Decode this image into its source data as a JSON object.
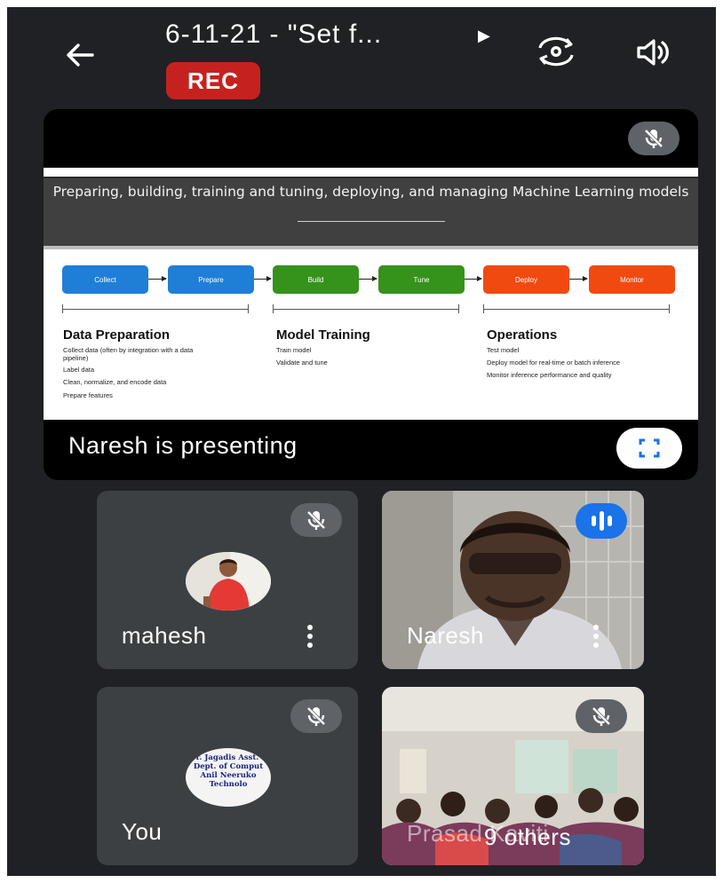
{
  "header": {
    "title": "6-11-21 - \"Set f...",
    "rec_label": "REC"
  },
  "icons": {
    "back": "arrow-left-icon",
    "title_expand": "triangle-right-icon",
    "camera_switch": "camera-switch-icon",
    "speaker": "speaker-icon",
    "mic_off": "mic-off-icon",
    "fullscreen": "fullscreen-icon",
    "more": "more-vert-icon",
    "speaking": "audio-level-icon"
  },
  "presentation": {
    "presenting_label": "Naresh is presenting",
    "slide": {
      "heading": "Preparing, building, training and tuning, deploying, and managing Machine Learning models",
      "steps": [
        "Collect",
        "Prepare",
        "Build",
        "Tune",
        "Deploy",
        "Monitor"
      ],
      "step_colors": [
        "#1f7fd6",
        "#1f7fd6",
        "#35921b",
        "#35921b",
        "#f04a11",
        "#f04a11"
      ],
      "columns": [
        {
          "title": "Data Preparation",
          "items": [
            "Collect data (often by integration with a data pipeline)",
            "Label data",
            "Clean, normalize, and encode data",
            "Prepare features"
          ]
        },
        {
          "title": "Model Training",
          "items": [
            "Train model",
            "Validate and tune"
          ]
        },
        {
          "title": "Operations",
          "items": [
            "Test model",
            "Deploy model for real-time or batch inference",
            "Monitor inference performance and quality"
          ]
        }
      ]
    }
  },
  "participants": [
    {
      "name": "mahesh",
      "muted": true,
      "speaking": false
    },
    {
      "name": "Naresh",
      "muted": false,
      "speaking": true
    },
    {
      "name": "You",
      "muted": true,
      "avatar_text": "Dr. Jagadis Asst. P Dept. of Comput Anil Neeruko Technolo"
    },
    {
      "name": "9 others",
      "muted": true,
      "overlay_text": "Prasad Kaviti"
    }
  ],
  "colors": {
    "background": "#202124",
    "tile": "#3c4043",
    "rec": "#c5221f",
    "speaking": "#1a73e8"
  }
}
